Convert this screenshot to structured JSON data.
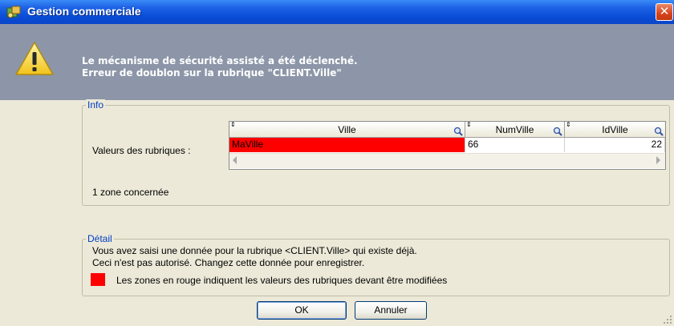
{
  "window": {
    "title": "Gestion commerciale"
  },
  "header": {
    "line1": "Le mécanisme de sécurité assisté a été déclenché.",
    "line2": "Erreur de doublon sur la rubrique \"CLIENT.Ville\""
  },
  "info": {
    "legend": "Info",
    "values_label": "Valeurs des rubriques :",
    "zone_count": "1 zone concernée",
    "table": {
      "columns": [
        "Ville",
        "NumVille",
        "IdVille"
      ],
      "row": [
        "MaVille",
        "66",
        "22"
      ],
      "error_color": "#FF0000"
    }
  },
  "detail": {
    "legend": "Détail",
    "line1": "Vous avez saisi une donnée pour la rubrique <CLIENT.Ville> qui existe déjà.",
    "line2": "Ceci n'est pas autorisé. Changez cette donnée pour enregistrer.",
    "legend_note": "Les zones en rouge indiquent les valeurs des rubriques devant être modifiées"
  },
  "buttons": {
    "ok": "OK",
    "cancel": "Annuler"
  },
  "icons": {
    "app": "app-icon",
    "warning": "warning-icon",
    "close": "close-icon",
    "search": "search-icon"
  }
}
